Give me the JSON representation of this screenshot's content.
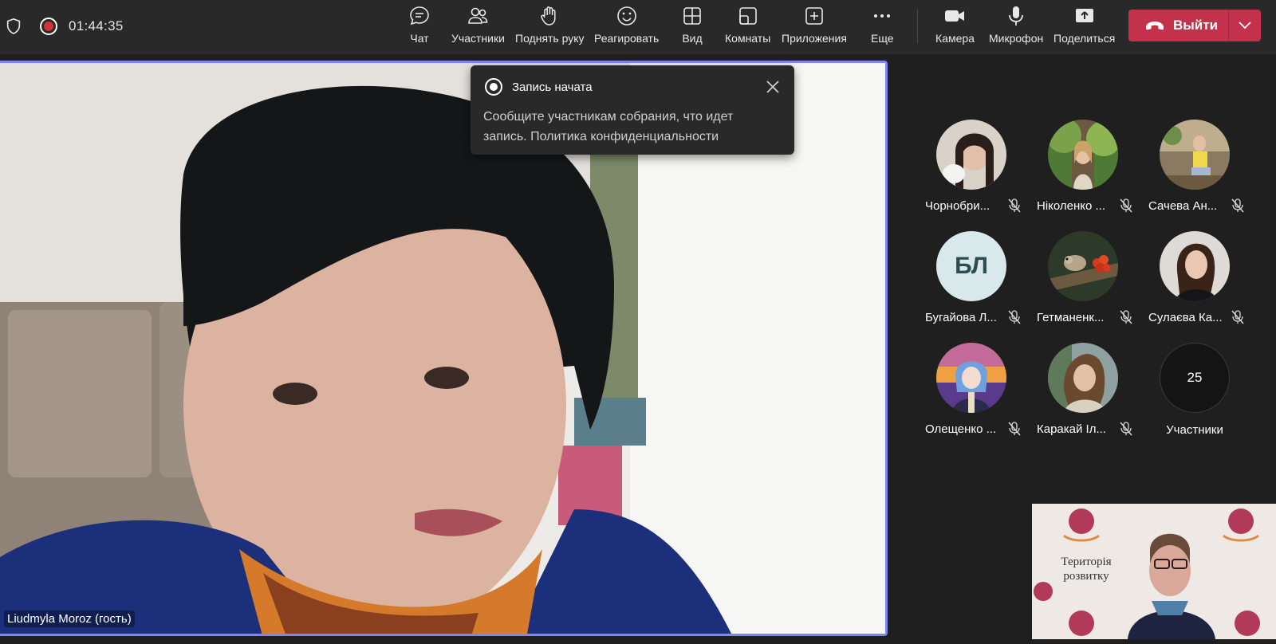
{
  "call": {
    "timer": "01:44:35"
  },
  "toolbar": {
    "chat": "Чат",
    "participants": "Участники",
    "raise_hand": "Поднять руку",
    "react": "Реагировать",
    "view": "Вид",
    "rooms": "Комнаты",
    "apps": "Приложения",
    "more": "Еще",
    "camera": "Камера",
    "mic": "Микрофон",
    "share": "Поделиться",
    "leave": "Выйти"
  },
  "colors": {
    "leave_button": "#c4314b",
    "active_speaker_border": "#7f85f5",
    "recording": "#d13438"
  },
  "main_video": {
    "speaker_name": "Liudmyla Moroz (гость)"
  },
  "toast": {
    "title": "Запись начата",
    "body": "Сообщите участникам собрания, что идет запись. Политика конфиденциальности"
  },
  "participants": [
    {
      "name": "Чорнобри...",
      "muted": true,
      "type": "photo"
    },
    {
      "name": "Ніколенко ...",
      "muted": true,
      "type": "photo"
    },
    {
      "name": "Сачева Ан...",
      "muted": true,
      "type": "photo"
    },
    {
      "name": "Бугайова Л...",
      "muted": true,
      "type": "initials",
      "initials": "БЛ"
    },
    {
      "name": "Гетманенк...",
      "muted": true,
      "type": "photo"
    },
    {
      "name": "Сулаєва Ка...",
      "muted": true,
      "type": "photo"
    },
    {
      "name": "Олещенко ...",
      "muted": true,
      "type": "photo"
    },
    {
      "name": "Каракай Іл...",
      "muted": true,
      "type": "photo"
    }
  ],
  "overflow": {
    "count": "25",
    "label": "Участники"
  },
  "self_view": {
    "backdrop_text": "Територія розвитку"
  }
}
